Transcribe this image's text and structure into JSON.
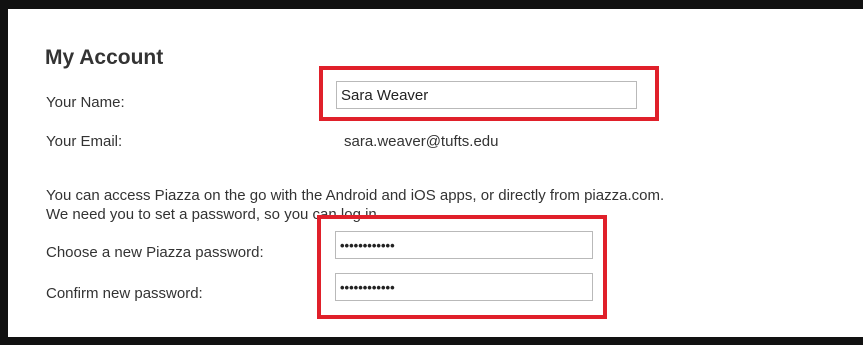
{
  "account": {
    "title": "My Account",
    "name_label": "Your Name:",
    "name_value": "Sara Weaver",
    "email_label": "Your Email:",
    "email_value": "sara.weaver@tufts.edu",
    "info_line1": "You can access Piazza on the go with the Android and iOS apps, or directly from piazza.com.",
    "info_line2": "We need you to set a password, so you can log in.",
    "new_password_label": "Choose a new Piazza password:",
    "new_password_value": "••••••••••••",
    "confirm_password_label": "Confirm new password:",
    "confirm_password_value": "••••••••••••"
  },
  "colors": {
    "highlight": "#e0202a",
    "frame": "#111111",
    "text": "#333333"
  }
}
